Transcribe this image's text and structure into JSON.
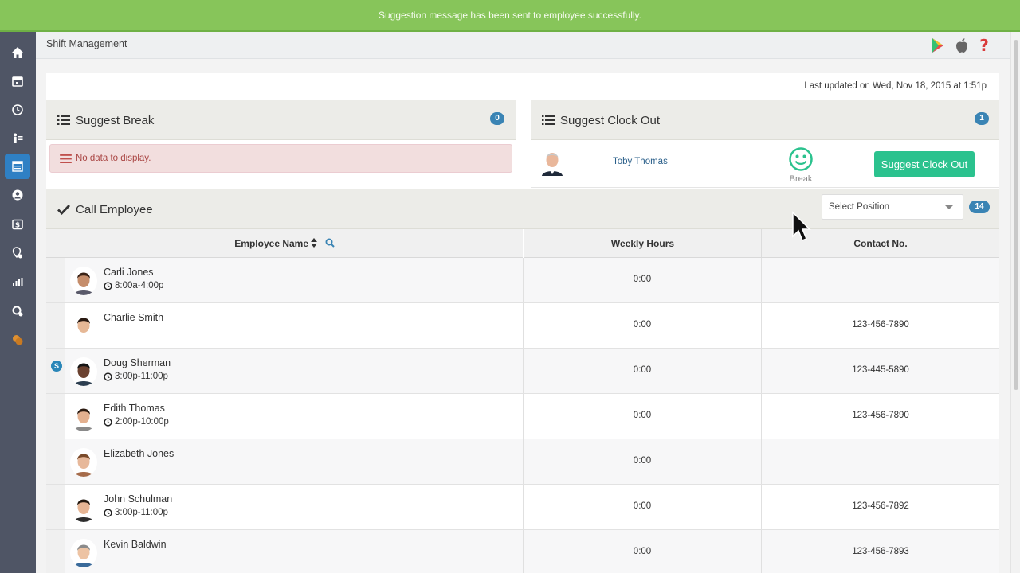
{
  "notification": "Suggestion message has been sent to employee successfully.",
  "header": {
    "title": "Shift Management"
  },
  "last_updated": "Last updated on Wed, Nov 18, 2015 at 1:51p",
  "suggest_break": {
    "title": "Suggest Break",
    "count": "0",
    "empty_message": "No data to display."
  },
  "suggest_clock_out": {
    "title": "Suggest Clock Out",
    "count": "1",
    "employee": {
      "name": "Toby Thomas",
      "status": "Break"
    },
    "button_label": "Suggest Clock Out"
  },
  "call_employee": {
    "title": "Call Employee",
    "position_select": "Select Position",
    "count": "14",
    "columns": [
      "Employee Name",
      "Weekly Hours",
      "Contact No."
    ],
    "rows": [
      {
        "name": "Carli Jones",
        "shift": "8:00a-4:00p",
        "hours": "0:00",
        "contact": "",
        "badge": ""
      },
      {
        "name": "Charlie Smith",
        "shift": "",
        "hours": "0:00",
        "contact": "123-456-7890",
        "badge": ""
      },
      {
        "name": "Doug Sherman",
        "shift": "3:00p-11:00p",
        "hours": "0:00",
        "contact": "123-445-5890",
        "badge": "S"
      },
      {
        "name": "Edith Thomas",
        "shift": "2:00p-10:00p",
        "hours": "0:00",
        "contact": "123-456-7890",
        "badge": ""
      },
      {
        "name": "Elizabeth Jones",
        "shift": "",
        "hours": "0:00",
        "contact": "",
        "badge": ""
      },
      {
        "name": "John Schulman",
        "shift": "3:00p-11:00p",
        "hours": "0:00",
        "contact": "123-456-7892",
        "badge": ""
      },
      {
        "name": "Kevin Baldwin",
        "shift": "",
        "hours": "0:00",
        "contact": "123-456-7893",
        "badge": ""
      }
    ]
  },
  "sidebar": {
    "items": [
      {
        "icon": "home-icon"
      },
      {
        "icon": "calendar-icon"
      },
      {
        "icon": "clock-icon"
      },
      {
        "icon": "staff-icon"
      },
      {
        "icon": "shift-list-icon",
        "active": true
      },
      {
        "icon": "user-icon"
      },
      {
        "icon": "payroll-icon"
      },
      {
        "icon": "location-settings-icon"
      },
      {
        "icon": "reports-icon"
      },
      {
        "icon": "settings-icon"
      },
      {
        "icon": "coins-icon"
      }
    ]
  },
  "colors": {
    "notification": "#87c55a",
    "sidebar": "#4f5565",
    "active": "#2f80c4",
    "action": "#2bc28e",
    "badge": "#3a84b4"
  }
}
